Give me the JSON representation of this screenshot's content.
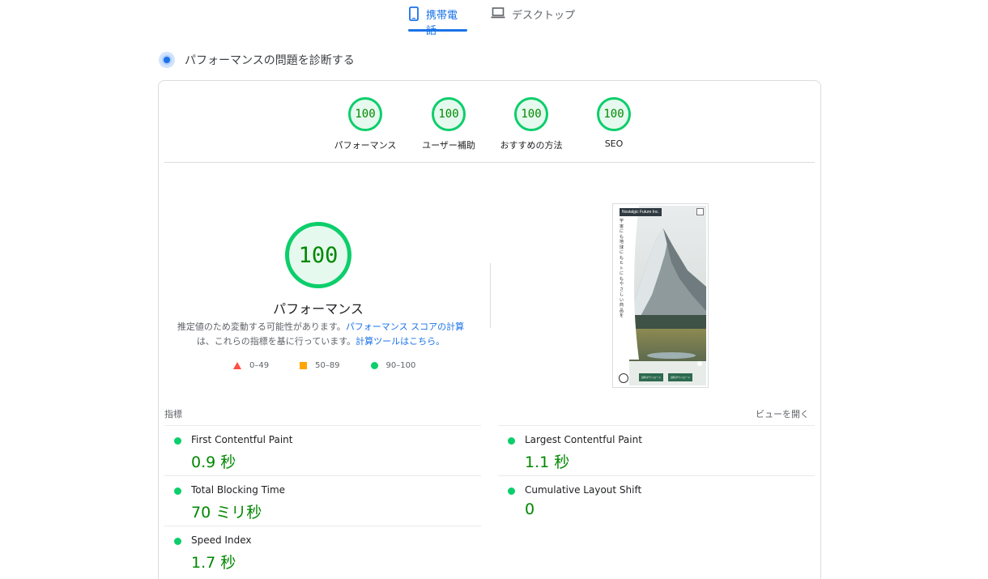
{
  "tabs": {
    "mobile_label": "携帯電話",
    "desktop_label": "デスクトップ"
  },
  "section": {
    "title": "パフォーマンスの問題を診断する"
  },
  "categories": [
    {
      "score": "100",
      "label": "パフォーマンス"
    },
    {
      "score": "100",
      "label": "ユーザー補助"
    },
    {
      "score": "100",
      "label": "おすすめの方法"
    },
    {
      "score": "100",
      "label": "SEO"
    }
  ],
  "performance": {
    "score": "100",
    "title": "パフォーマンス",
    "desc_1": "推定値のため変動する可能性があります。",
    "desc_link_1": "パフォーマンス スコアの計算",
    "desc_2": "は、これらの指標を基に行っています。",
    "desc_link_2": "計算ツールはこちら。",
    "legend": {
      "fail": "0–49",
      "average": "50–89",
      "pass": "90–100"
    }
  },
  "screenshot": {
    "brand": "Nostalgic Future Inc.",
    "vertical_text": "宇宙にも地球にもヒトにもやさしい商品を",
    "button_1": "資料ダウンロード",
    "button_2": "資料ダウンロード"
  },
  "metrics": {
    "label": "指標",
    "view_toggle": "ビューを開く",
    "items": [
      {
        "name": "First Contentful Paint",
        "value": "0.9 秒"
      },
      {
        "name": "Largest Contentful Paint",
        "value": "1.1 秒"
      },
      {
        "name": "Total Blocking Time",
        "value": "70 ミリ秒"
      },
      {
        "name": "Cumulative Layout Shift",
        "value": "0"
      },
      {
        "name": "Speed Index",
        "value": "1.7 秒"
      }
    ]
  },
  "colors": {
    "pass": "#0cce6b",
    "pass_text": "#008800",
    "average": "#ffa400",
    "fail": "#ff4e42",
    "accent": "#1a73e8"
  },
  "icons": {
    "mobile_tab": "smartphone-icon",
    "desktop_tab": "laptop-icon",
    "section": "diagnose-icon"
  }
}
